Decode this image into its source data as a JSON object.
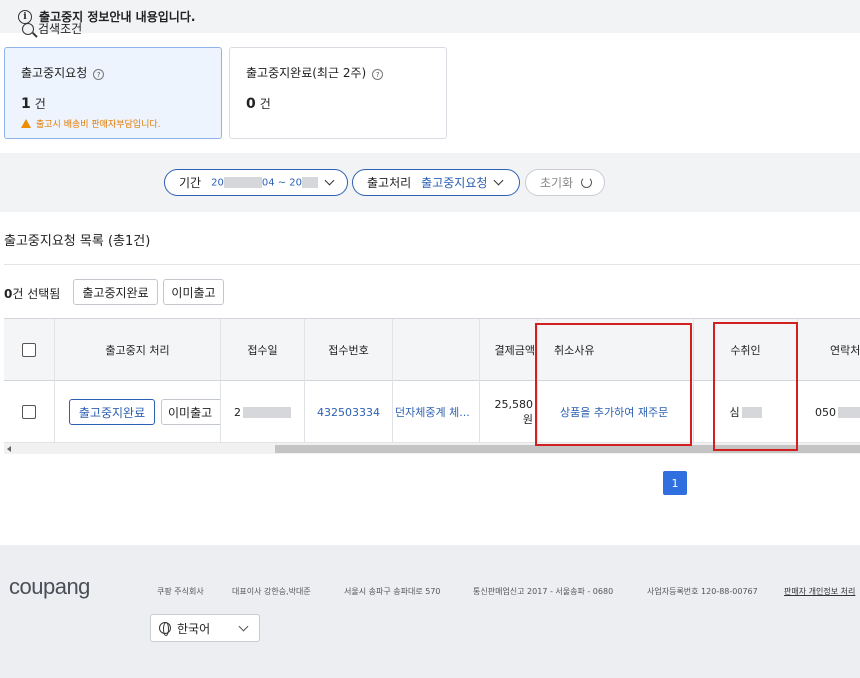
{
  "info": {
    "text": "출고중지 정보안내 내용입니다.",
    "icon": "info-icon"
  },
  "cards": [
    {
      "title": "출고중지요청",
      "count": "1",
      "unit": "건",
      "warning": "출고시 배송비 판매자부담입니다."
    },
    {
      "title": "출고중지완료(최근 2주)",
      "count": "0",
      "unit": "건"
    }
  ],
  "search": {
    "label": "검색조건",
    "period_label": "기간",
    "period_start": "20",
    "period_mid": "04 ~ 20",
    "process_label": "출고처리",
    "process_value": "출고중지요청",
    "reset_label": "초기화"
  },
  "list": {
    "title": "출고중지요청 목록 (총1건)",
    "selected_count": "0",
    "selected_suffix": "건 선택됨",
    "btn_complete": "출고중지완료",
    "btn_already": "이미출고"
  },
  "table": {
    "headers": {
      "process": "출고중지 처리",
      "received_date": "접수일",
      "received_no": "접수번호",
      "payment": "결제금액",
      "reason": "취소사유",
      "recipient": "수취인",
      "contact": "연락처"
    },
    "row": {
      "btn_complete": "출고중지완료",
      "btn_already": "이미출고",
      "date_prefix": "2",
      "received_no": "432503334",
      "product": "던자체중계 체...",
      "payment_amount": "25,580",
      "payment_unit": "원",
      "reason": "상품을 추가하여 재주문",
      "recipient_prefix": "심",
      "contact_prefix": "050"
    }
  },
  "pagination": {
    "current": "1"
  },
  "footer": {
    "logo": "coupang",
    "company": "쿠팡 주식회사",
    "ceo": "대표이사 강한승,박대준",
    "address": "서울시 송파구 송파대로 570",
    "telecom": "통신판매업신고 2017 - 서울송파 - 0680",
    "biz_no": "사업자등록번호 120-88-00767",
    "privacy": "판매자 개인정보 처리",
    "language": "한국어"
  },
  "colors": {
    "accent": "#2d61b3",
    "warning": "#e37a00",
    "highlight": "#d21f1f",
    "page_active": "#2f6fe0"
  }
}
